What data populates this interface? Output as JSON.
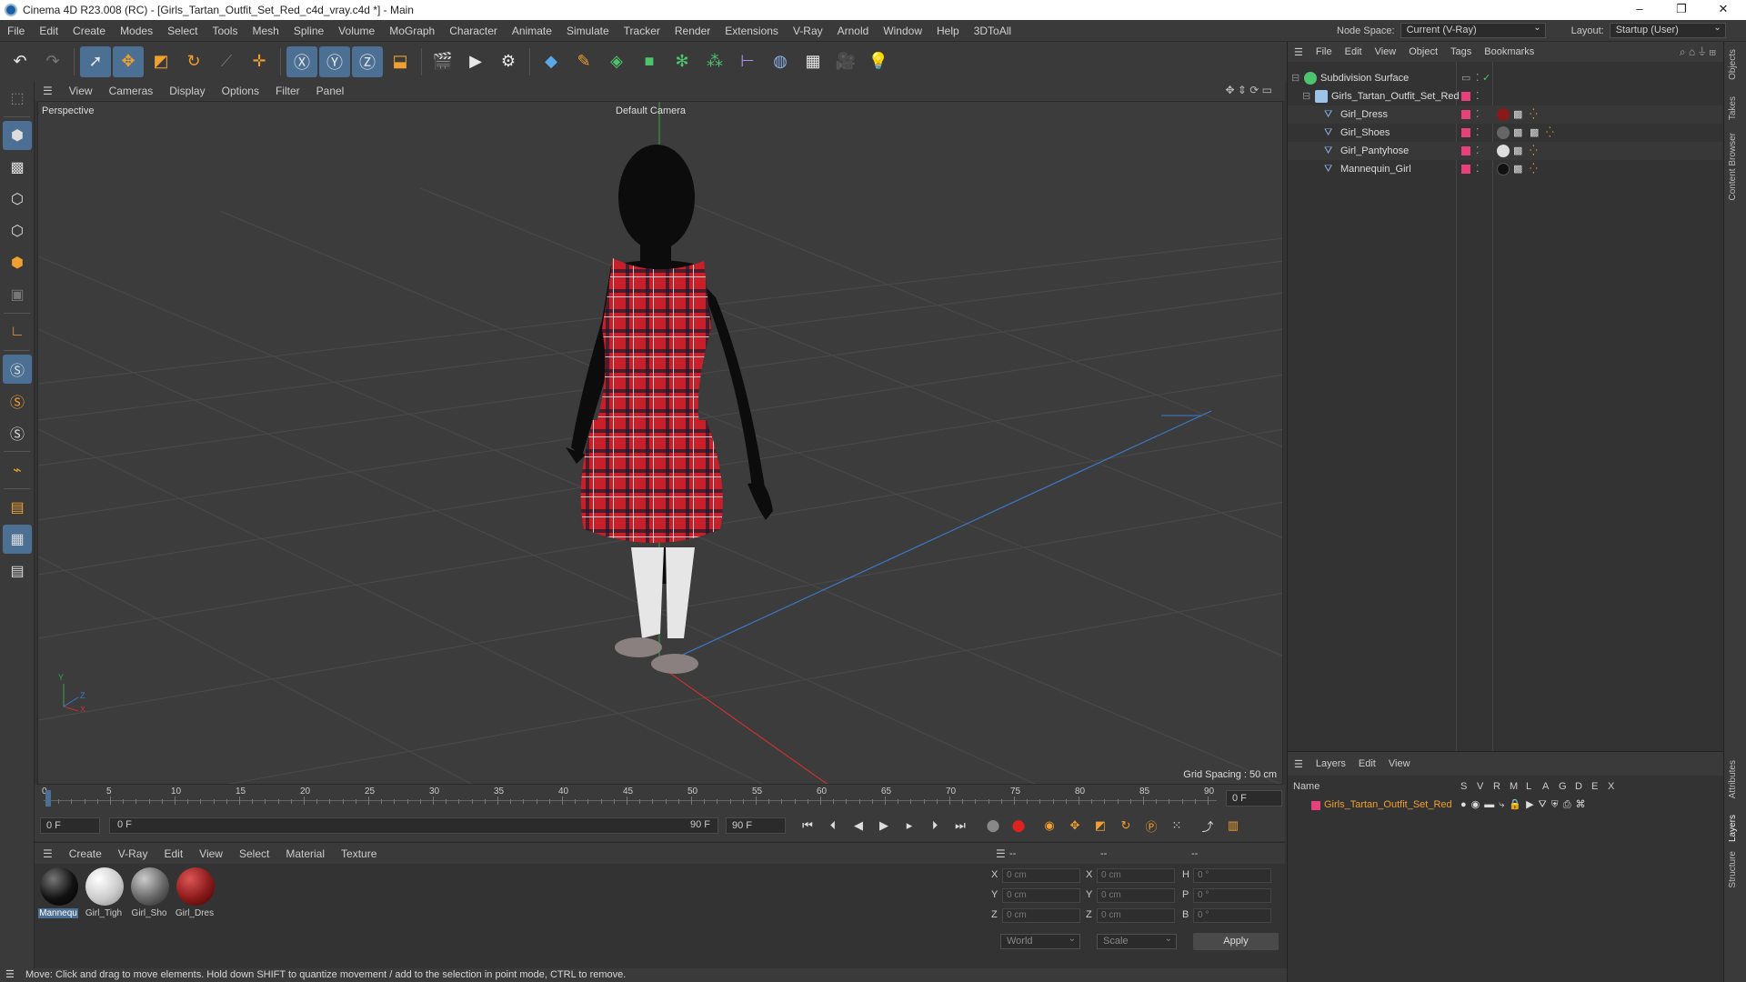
{
  "window": {
    "title": "Cinema 4D R23.008 (RC) - [Girls_Tartan_Outfit_Set_Red_c4d_vray.c4d *] - Main",
    "minimize": "–",
    "maximize": "❐",
    "close": "✕"
  },
  "menubar": {
    "items": [
      "File",
      "Edit",
      "Create",
      "Modes",
      "Select",
      "Tools",
      "Mesh",
      "Spline",
      "Volume",
      "MoGraph",
      "Character",
      "Animate",
      "Simulate",
      "Tracker",
      "Render",
      "Extensions",
      "V-Ray",
      "Arnold",
      "Window",
      "Help",
      "3DToAll"
    ],
    "node_space_label": "Node Space:",
    "node_space_value": "Current (V-Ray)",
    "layout_label": "Layout:",
    "layout_value": "Startup (User)"
  },
  "viewport": {
    "menu": [
      "View",
      "Cameras",
      "Display",
      "Options",
      "Filter",
      "Panel"
    ],
    "label": "Perspective",
    "camera": "Default Camera",
    "grid_spacing": "Grid Spacing : 50 cm",
    "axis_y": "Y",
    "axis_z": "Z",
    "axis_x": "X"
  },
  "timeline": {
    "ticks": [
      "0",
      "5",
      "10",
      "15",
      "20",
      "25",
      "30",
      "35",
      "40",
      "45",
      "50",
      "55",
      "60",
      "65",
      "70",
      "75",
      "80",
      "85",
      "90"
    ],
    "current_frame": "0 F"
  },
  "transport": {
    "start": "0 F",
    "range_start": "0 F",
    "range_end": "90 F",
    "end": "90 F"
  },
  "materials": {
    "menu": [
      "Create",
      "V-Ray",
      "Edit",
      "View",
      "Select",
      "Material",
      "Texture"
    ],
    "items": [
      {
        "label": "Mannequ",
        "color": "#111111"
      },
      {
        "label": "Girl_Tigh",
        "color": "#d8d8d8"
      },
      {
        "label": "Girl_Sho",
        "color": "#6a6a6a"
      },
      {
        "label": "Girl_Dres",
        "color": "#8a1a1a"
      }
    ]
  },
  "coords": {
    "headers": [
      "--",
      "--",
      "--"
    ],
    "rows": [
      {
        "a": "X",
        "av": "0 cm",
        "b": "X",
        "bv": "0 cm",
        "c": "H",
        "cv": "0 °"
      },
      {
        "a": "Y",
        "av": "0 cm",
        "b": "Y",
        "bv": "0 cm",
        "c": "P",
        "cv": "0 °"
      },
      {
        "a": "Z",
        "av": "0 cm",
        "b": "Z",
        "bv": "0 cm",
        "c": "B",
        "cv": "0 °"
      }
    ],
    "world": "World",
    "scale": "Scale",
    "apply": "Apply"
  },
  "objects": {
    "menu": [
      "File",
      "Edit",
      "View",
      "Object",
      "Tags",
      "Bookmarks"
    ],
    "tree": [
      {
        "name": "Subdivision Surface",
        "indent": 0
      },
      {
        "name": "Girls_Tartan_Outfit_Set_Red",
        "indent": 1
      },
      {
        "name": "Girl_Dress",
        "indent": 2
      },
      {
        "name": "Girl_Shoes",
        "indent": 2
      },
      {
        "name": "Girl_Pantyhose",
        "indent": 2
      },
      {
        "name": "Mannequin_Girl",
        "indent": 2
      }
    ]
  },
  "layers": {
    "menu": [
      "Layers",
      "Edit",
      "View"
    ],
    "columns": [
      "Name",
      "S",
      "V",
      "R",
      "M",
      "L",
      "A",
      "G",
      "D",
      "E",
      "X"
    ],
    "rows": [
      {
        "name": "Girls_Tartan_Outfit_Set_Red",
        "color": "#e8407a"
      }
    ]
  },
  "right_tabs": [
    "Objects",
    "Takes",
    "Content Browser",
    "Attributes",
    "Layers",
    "Structure"
  ],
  "status": "Move: Click and drag to move elements. Hold down SHIFT to quantize movement / add to the selection in point mode, CTRL to remove."
}
